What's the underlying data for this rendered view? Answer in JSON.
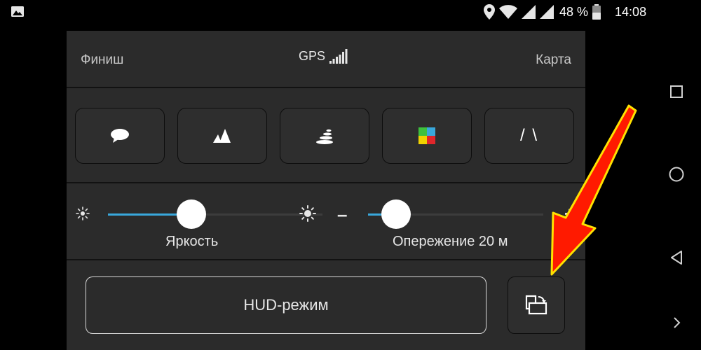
{
  "status_bar": {
    "battery": "48 %",
    "time": "14:08",
    "icons": [
      "gallery-icon",
      "location-icon",
      "wifi-icon",
      "signal-icon",
      "signal-icon",
      "battery-icon"
    ]
  },
  "header": {
    "left_label": "Финиш",
    "center_label": "GPS",
    "right_label": "Карта"
  },
  "mode_buttons": [
    {
      "icon": "speech-bubble-icon"
    },
    {
      "icon": "mountains-icon"
    },
    {
      "icon": "stack-icon"
    },
    {
      "icon": "color-squares-icon"
    },
    {
      "icon": "road-icon",
      "text": "/ \\"
    }
  ],
  "sliders": {
    "brightness": {
      "label": "Яркость",
      "value": 0.39
    },
    "advance": {
      "label": "Опережение 20 м",
      "minus": "–",
      "plus": "+",
      "value": 0.16
    }
  },
  "bottom": {
    "hud_label": "HUD-режим",
    "rotate_icon": "screen-rotate-icon"
  },
  "colors": {
    "accent": "#39a8dc",
    "panel": "#2b2b2b",
    "arrow": "#ff1a00",
    "arrow_outline": "#ffe100"
  }
}
